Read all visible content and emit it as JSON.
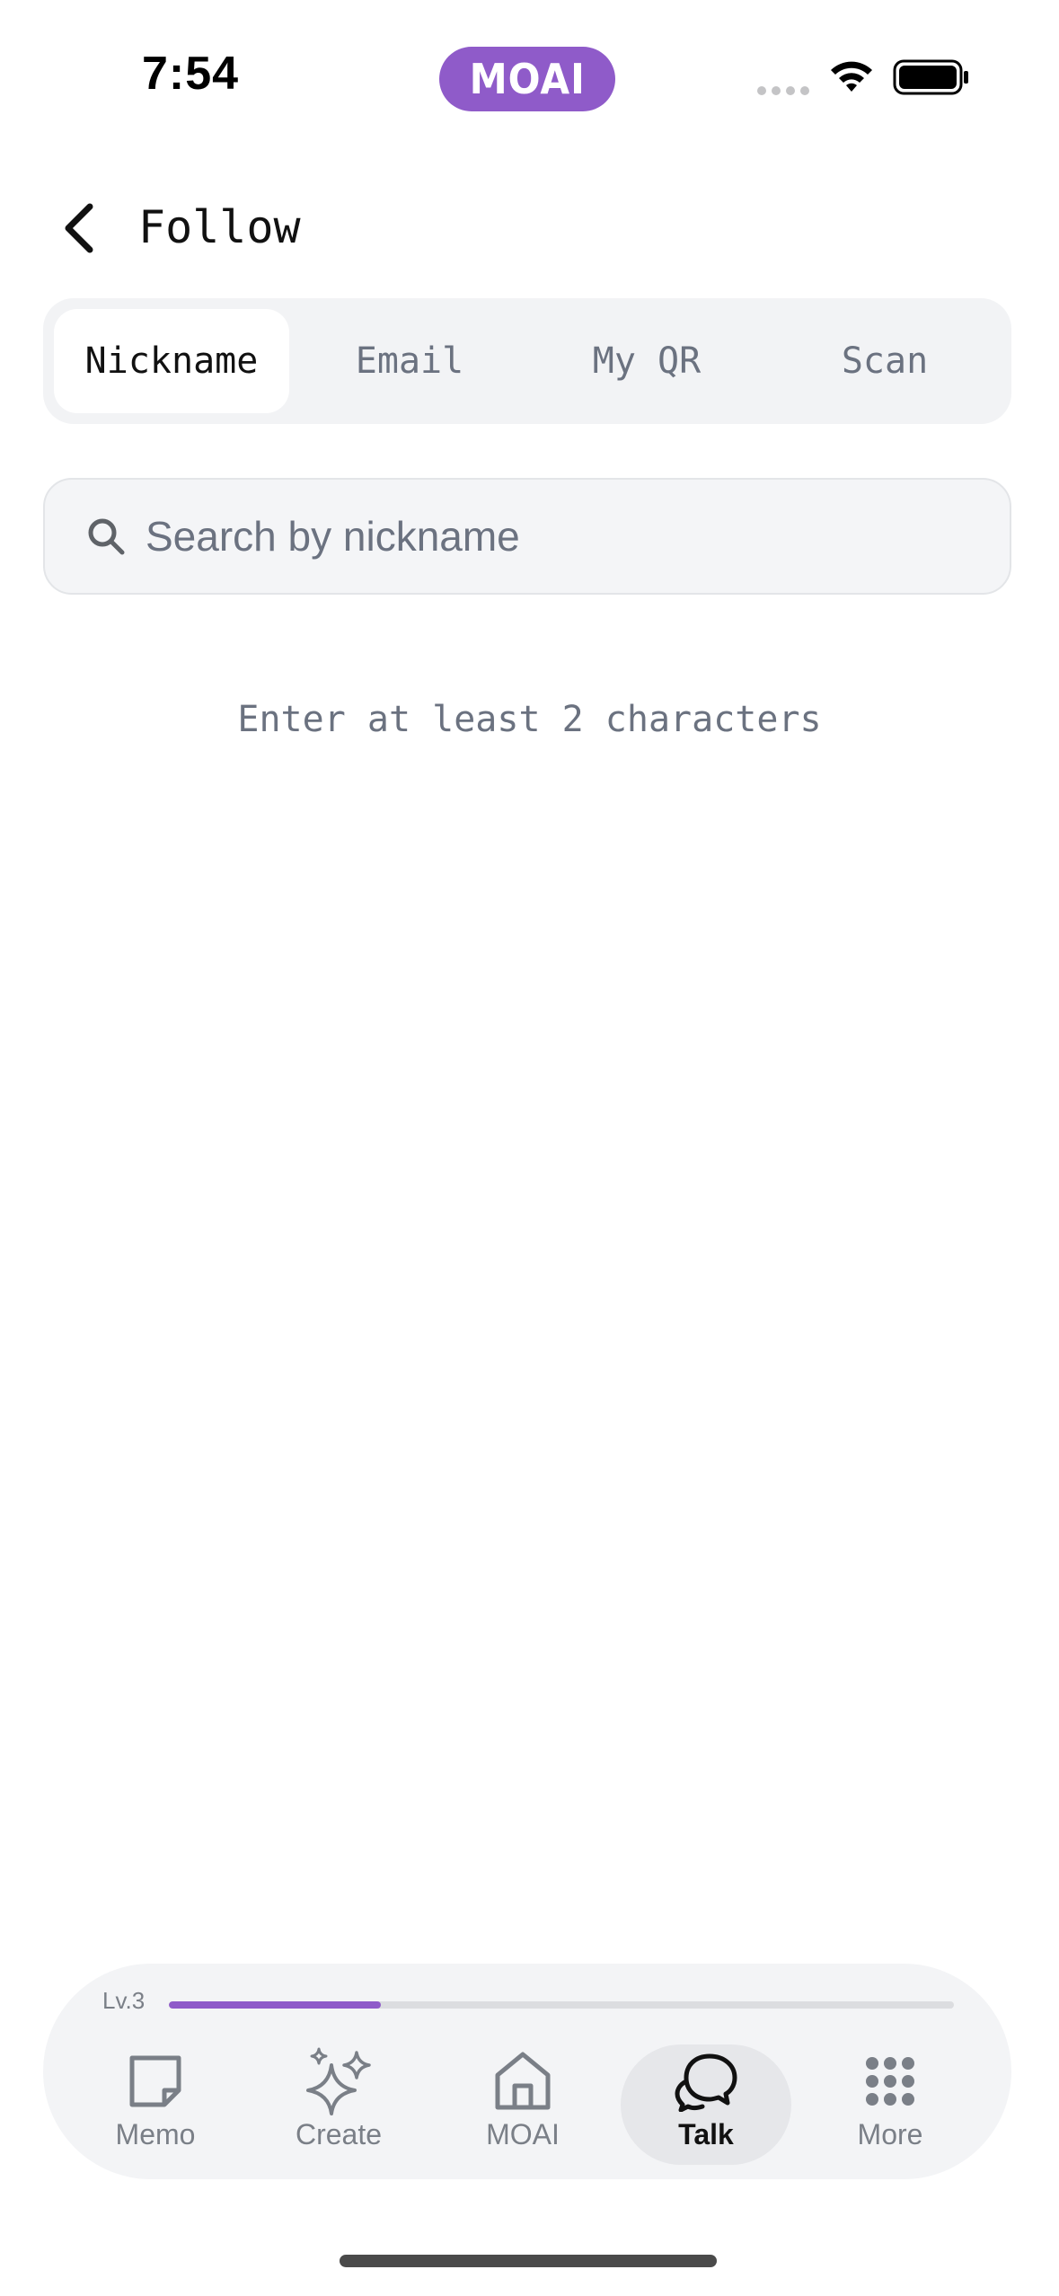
{
  "status_bar": {
    "time": "7:54",
    "island_text": "MOAI",
    "icons": [
      "cellular-signal-icon",
      "wifi-icon",
      "battery-icon"
    ]
  },
  "header": {
    "title": "Follow",
    "back_icon": "chevron-left-icon"
  },
  "tabs": [
    {
      "label": "Nickname",
      "active": true
    },
    {
      "label": "Email",
      "active": false
    },
    {
      "label": "My QR",
      "active": false
    },
    {
      "label": "Scan",
      "active": false
    }
  ],
  "search": {
    "placeholder": "Search by nickname",
    "value": "",
    "icon": "search-icon"
  },
  "hint": "Enter at least 2 characters",
  "bottom_nav": {
    "level_label": "Lv.3",
    "level_progress": 0.27,
    "items": [
      {
        "label": "Memo",
        "icon": "memo-icon",
        "active": false
      },
      {
        "label": "Create",
        "icon": "sparkle-icon",
        "active": false
      },
      {
        "label": "MOAI",
        "icon": "home-icon",
        "active": false
      },
      {
        "label": "Talk",
        "icon": "chat-bubbles-icon",
        "active": true
      },
      {
        "label": "More",
        "icon": "grid-dots-icon",
        "active": false
      }
    ]
  },
  "colors": {
    "accent": "#8f5bc9",
    "muted_text": "#6b7280",
    "surface": "#f2f3f5"
  }
}
